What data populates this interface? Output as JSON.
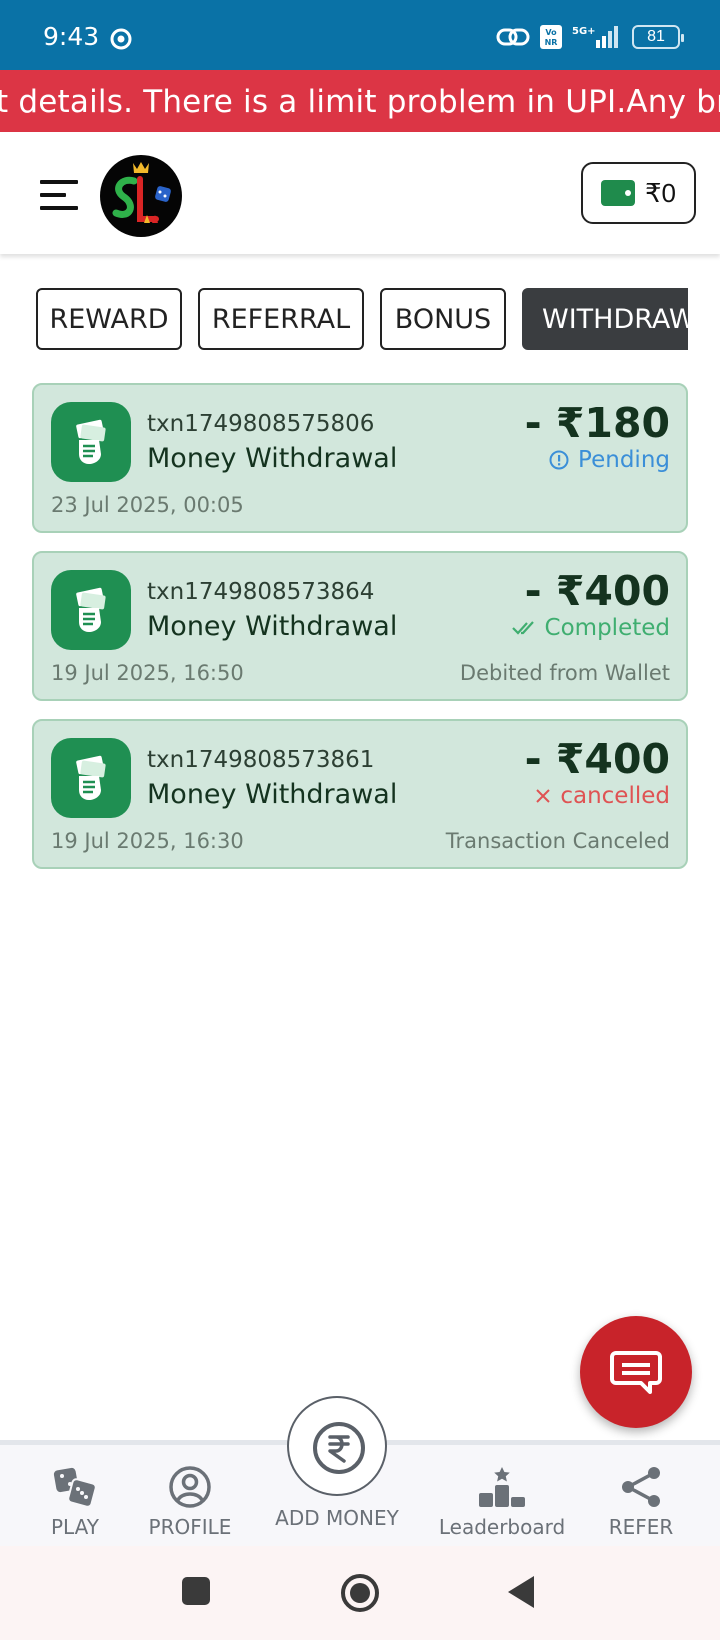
{
  "status_bar": {
    "time": "9:43",
    "network": "5G+",
    "volte": "Vo NR",
    "battery": "81"
  },
  "announcement": {
    "text": "t details. There is a limit problem in UPI.Any brother"
  },
  "header": {
    "wallet_balance": "₹0"
  },
  "tabs": [
    {
      "label": "REWARD",
      "active": false
    },
    {
      "label": "REFERRAL",
      "active": false
    },
    {
      "label": "BONUS",
      "active": false
    },
    {
      "label": "WITHDRAWAL",
      "active": true
    }
  ],
  "transactions": [
    {
      "id": "txn1749808575806",
      "title": "Money Withdrawal",
      "amount": "- ₹180",
      "status": "Pending",
      "date": "23 Jul 2025, 00:05",
      "note": ""
    },
    {
      "id": "txn1749808573864",
      "title": "Money Withdrawal",
      "amount": "- ₹400",
      "status": "Completed",
      "date": "19 Jul 2025, 16:50",
      "note": "Debited from Wallet"
    },
    {
      "id": "txn1749808573861",
      "title": "Money Withdrawal",
      "amount": "- ₹400",
      "status": "cancelled",
      "date": "19 Jul 2025, 16:30",
      "note": "Transaction Canceled"
    }
  ],
  "bottom_nav": {
    "play": "PLAY",
    "profile": "PROFILE",
    "add_money": "ADD MONEY",
    "leaderboard": "Leaderboard",
    "refer": "REFER"
  },
  "colors": {
    "status_bar": "#0a72a6",
    "announcement_bg": "#dc3545",
    "card_bg": "#d2e7dc",
    "accent_green": "#1f8f52",
    "pending": "#3b8fd8",
    "completed": "#3fae70",
    "cancelled": "#df5353",
    "fab": "#c8232a"
  }
}
